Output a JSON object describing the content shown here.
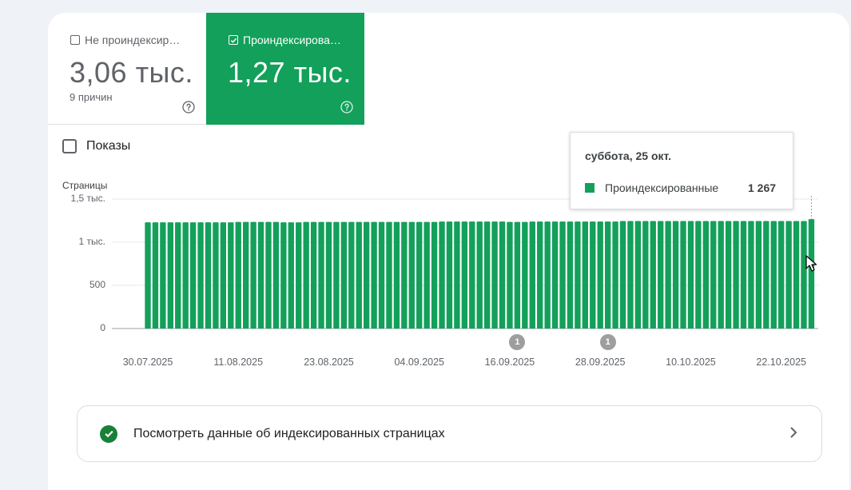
{
  "tiles": {
    "not_indexed": {
      "label": "Не проиндексир…",
      "value": "3,06 тыс.",
      "sub": "9 причин",
      "checked": false
    },
    "indexed": {
      "label": "Проиндексирова…",
      "value": "1,27 тыс.",
      "checked": true
    }
  },
  "impressions": {
    "label": "Показы",
    "checked": false
  },
  "colors": {
    "accent": "#13a05a",
    "success": "#188038",
    "marker": "#9e9e9e"
  },
  "chart_data": {
    "type": "bar",
    "ylabel": "Страницы",
    "ylim": [
      0,
      1500
    ],
    "yticks": [
      {
        "value": 0,
        "label": "0"
      },
      {
        "value": 500,
        "label": "500"
      },
      {
        "value": 1000,
        "label": "1 тыс."
      },
      {
        "value": 1500,
        "label": "1,5 тыс."
      }
    ],
    "xticks": [
      "30.07.2025",
      "11.08.2025",
      "23.08.2025",
      "04.09.2025",
      "16.09.2025",
      "28.09.2025",
      "10.10.2025",
      "22.10.2025"
    ],
    "x_start": "30.07.2025",
    "x_end": "25.10.2025",
    "series": [
      {
        "name": "Проиндексированные",
        "color": "#13a05a",
        "values": [
          1230,
          1230,
          1230,
          1230,
          1230,
          1230,
          1230,
          1230,
          1230,
          1230,
          1230,
          1230,
          1235,
          1235,
          1235,
          1235,
          1235,
          1235,
          1230,
          1230,
          1230,
          1235,
          1235,
          1235,
          1235,
          1235,
          1235,
          1235,
          1235,
          1235,
          1235,
          1235,
          1235,
          1235,
          1235,
          1235,
          1235,
          1235,
          1235,
          1240,
          1240,
          1240,
          1240,
          1240,
          1240,
          1240,
          1240,
          1240,
          1235,
          1235,
          1235,
          1240,
          1240,
          1240,
          1240,
          1240,
          1240,
          1240,
          1240,
          1240,
          1240,
          1240,
          1240,
          1245,
          1245,
          1245,
          1245,
          1245,
          1245,
          1245,
          1245,
          1245,
          1245,
          1245,
          1245,
          1245,
          1245,
          1245,
          1245,
          1245,
          1245,
          1245,
          1245,
          1245,
          1245,
          1245,
          1245,
          1245,
          1267
        ]
      }
    ],
    "annotations": [
      {
        "label": "1",
        "x": "17.09.2025"
      },
      {
        "label": "1",
        "x": "29.09.2025"
      }
    ],
    "tooltip": {
      "date": "суббота, 25 окт.",
      "series": "Проиндексированные",
      "value": "1 267"
    }
  },
  "link": {
    "label": "Посмотреть данные об индексированных страницах"
  }
}
